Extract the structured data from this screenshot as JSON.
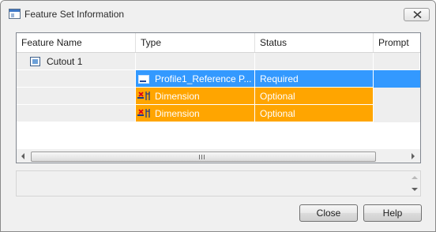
{
  "window": {
    "title": "Feature Set Information",
    "icons": {
      "app": "window-app-icon",
      "close": "close-icon"
    }
  },
  "grid": {
    "columns": [
      "Feature Name",
      "Type",
      "Status",
      "Prompt"
    ],
    "rows": [
      {
        "kind": "feature",
        "name": "Cutout 1",
        "icon": "feature-node-icon",
        "type": "",
        "status": "",
        "prompt": ""
      },
      {
        "kind": "reference",
        "name": "",
        "icon": "profile-reference-icon",
        "type": "Profile1_Reference P...",
        "status": "Required",
        "prompt": "",
        "highlight": "#3399ff"
      },
      {
        "kind": "dimension",
        "name": "",
        "icon": "dimension-icon",
        "type": "Dimension",
        "status": "Optional",
        "prompt": "",
        "highlight": "#ffa500"
      },
      {
        "kind": "dimension",
        "name": "",
        "icon": "dimension-icon",
        "type": "Dimension",
        "status": "Optional",
        "prompt": "",
        "highlight": "#ffa500"
      }
    ]
  },
  "info_box": {
    "text": ""
  },
  "buttons": {
    "close": "Close",
    "help": "Help"
  },
  "colors": {
    "selected": "#3399ff",
    "optional": "#ffa500",
    "rowgrey": "#eeeeee"
  }
}
